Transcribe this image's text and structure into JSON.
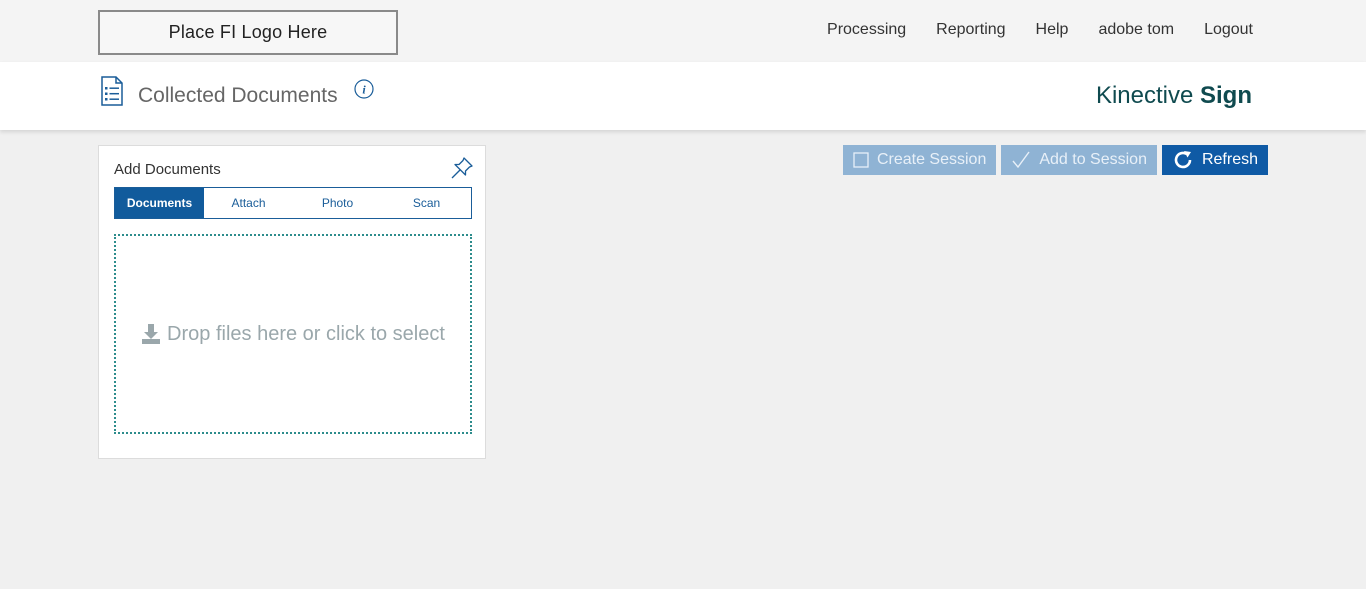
{
  "header": {
    "logo_text": "Place FI Logo Here",
    "nav": {
      "processing": "Processing",
      "reporting": "Reporting",
      "help": "Help",
      "user": "adobe tom",
      "logout": "Logout"
    }
  },
  "titlebar": {
    "title": "Collected Documents",
    "brand_light": "Kinective",
    "brand_bold": "Sign",
    "icons": [
      "document-list-icon",
      "info-icon"
    ]
  },
  "panel": {
    "title": "Add Documents",
    "pin_icon": "pin-icon",
    "tabs": {
      "documents": "Documents",
      "attach": "Attach",
      "photo": "Photo",
      "scan": "Scan",
      "active": "Documents"
    },
    "dropzone_text": "Drop files here or click to select",
    "dropzone_icon": "download-icon"
  },
  "actions": {
    "create_session": "Create Session",
    "add_to_session": "Add to Session",
    "refresh": "Refresh"
  },
  "colors": {
    "primary": "#0f5aa5",
    "disabled": "#8fb3d4",
    "brand": "#0f4a4f",
    "dropzone_border": "#2d8c8c"
  }
}
